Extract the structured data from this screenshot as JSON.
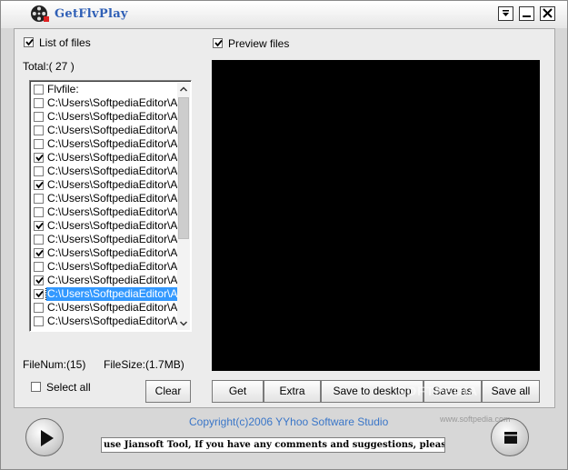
{
  "window": {
    "title": "GetFlvPlay",
    "controls": {
      "menu_icon": "dropdown-icon",
      "minimize_icon": "minimize-icon",
      "close_icon": "close-icon"
    }
  },
  "left": {
    "list_of_files_label": "List of files",
    "list_of_files_checked": true,
    "total_label": "Total:( 27 )",
    "file_num_label": "FileNum:(15)",
    "file_size_label": "FileSize:(1.7MB)",
    "select_all_label": "Select all",
    "select_all_checked": false,
    "clear_button": "Clear"
  },
  "file_list": {
    "items": [
      {
        "label": "Flvfile:",
        "checked": false,
        "selected": false
      },
      {
        "label": "C:\\Users\\SoftpediaEditor\\AppData",
        "checked": false,
        "selected": false
      },
      {
        "label": "C:\\Users\\SoftpediaEditor\\AppData",
        "checked": false,
        "selected": false
      },
      {
        "label": "C:\\Users\\SoftpediaEditor\\AppData",
        "checked": false,
        "selected": false
      },
      {
        "label": "C:\\Users\\SoftpediaEditor\\AppData",
        "checked": false,
        "selected": false
      },
      {
        "label": "C:\\Users\\SoftpediaEditor\\AppData",
        "checked": true,
        "selected": false
      },
      {
        "label": "C:\\Users\\SoftpediaEditor\\AppData",
        "checked": false,
        "selected": false
      },
      {
        "label": "C:\\Users\\SoftpediaEditor\\AppData",
        "checked": true,
        "selected": false
      },
      {
        "label": "C:\\Users\\SoftpediaEditor\\AppData",
        "checked": false,
        "selected": false
      },
      {
        "label": "C:\\Users\\SoftpediaEditor\\AppData",
        "checked": false,
        "selected": false
      },
      {
        "label": "C:\\Users\\SoftpediaEditor\\AppData",
        "checked": true,
        "selected": false
      },
      {
        "label": "C:\\Users\\SoftpediaEditor\\AppData",
        "checked": false,
        "selected": false
      },
      {
        "label": "C:\\Users\\SoftpediaEditor\\AppData",
        "checked": true,
        "selected": false
      },
      {
        "label": "C:\\Users\\SoftpediaEditor\\AppData",
        "checked": false,
        "selected": false
      },
      {
        "label": "C:\\Users\\SoftpediaEditor\\AppData",
        "checked": true,
        "selected": false
      },
      {
        "label": "C:\\Users\\SoftpediaEditor\\AppData",
        "checked": true,
        "selected": true
      },
      {
        "label": "C:\\Users\\SoftpediaEditor\\AppData",
        "checked": false,
        "selected": false
      },
      {
        "label": "C:\\Users\\SoftpediaEditor\\AppData",
        "checked": false,
        "selected": false
      }
    ]
  },
  "right": {
    "preview_files_label": "Preview files",
    "preview_files_checked": true,
    "buttons": {
      "get": "Get",
      "extra": "Extra",
      "save_to_desktop": "Save to desktop",
      "save_as": "Save as",
      "save_all": "Save all"
    }
  },
  "footer": {
    "copyright": "Copyright(c)2006 YYhoo Software Studio",
    "marquee": "use Jiansoft Tool, If you have any comments and suggestions, please click here!",
    "play_icon": "play-icon",
    "stop_icon": "stop-icon"
  },
  "watermark": {
    "text": "SOFTPEDIA",
    "url": "www.softpedia.com"
  },
  "colors": {
    "title": "#2f5fb6",
    "copyright": "#3a76c8",
    "selection": "#3399ff",
    "preview_bg": "#000000"
  }
}
